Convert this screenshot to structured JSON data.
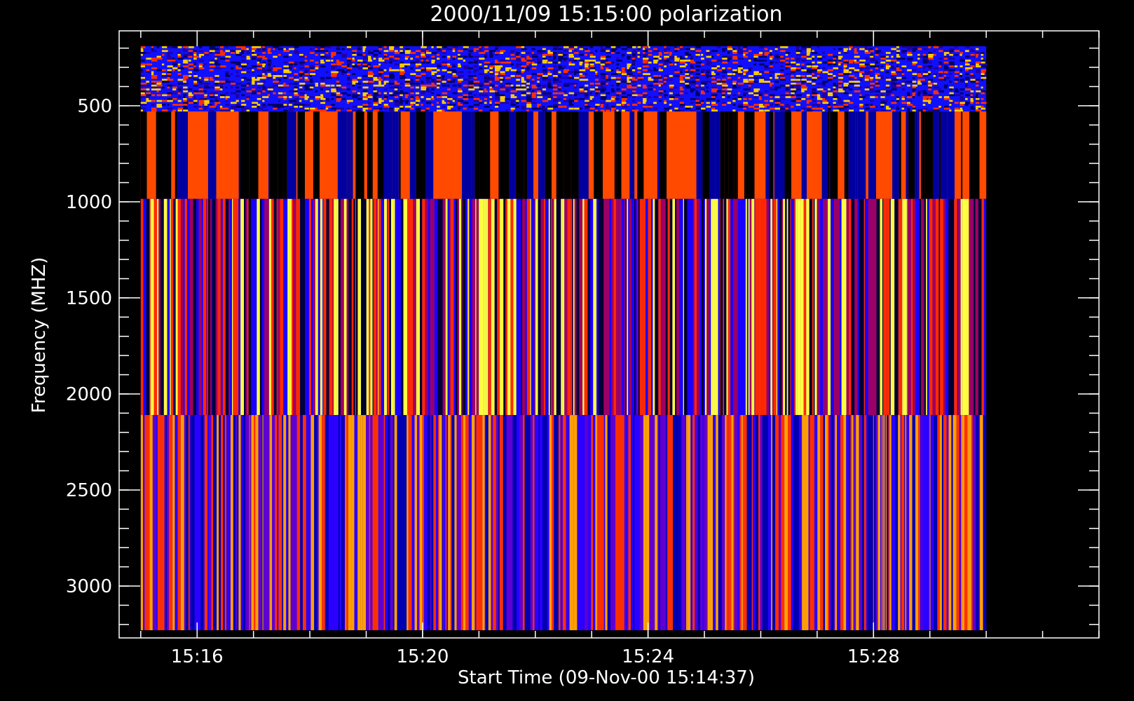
{
  "chart_data": {
    "type": "heatmap",
    "title": "2000/11/09 15:15:00 polarization",
    "xlabel": "Start Time (09-Nov-00 15:14:37)",
    "ylabel": "Frequency (MHZ)",
    "x_axis": {
      "unit": "time",
      "start": "15:14:37",
      "range": [
        "15:14:37",
        "15:32:00"
      ],
      "major_ticks": [
        {
          "value": "15:16",
          "label": "15:16"
        },
        {
          "value": "15:20",
          "label": "15:20"
        },
        {
          "value": "15:24",
          "label": "15:24"
        },
        {
          "value": "15:28",
          "label": "15:28"
        }
      ],
      "minor_tick_interval_minutes": 1
    },
    "y_axis": {
      "unit": "MHz",
      "inverted": true,
      "range": [
        110,
        3270
      ],
      "major_ticks": [
        500,
        1000,
        1500,
        2000,
        2500,
        3000
      ],
      "minor_tick_interval": 100
    },
    "data_time_range": [
      "15:15:00",
      "15:30:00"
    ],
    "bands": [
      {
        "freq_range": [
          190,
          530
        ],
        "pattern": "fine-noise",
        "colors": [
          "#1010ff",
          "#ff3000",
          "#000060",
          "#ffd000",
          "#2000a0"
        ]
      },
      {
        "freq_range": [
          530,
          985
        ],
        "pattern": "vertical-stripes",
        "colors": [
          "#ff4a00",
          "#000000",
          "#0000a0"
        ]
      },
      {
        "freq_range": [
          985,
          2110
        ],
        "pattern": "vertical-stripes",
        "colors": [
          "#1a00ff",
          "#ff2a00",
          "#000030",
          "#ffff40",
          "#a00060"
        ]
      },
      {
        "freq_range": [
          2110,
          3230
        ],
        "pattern": "vertical-stripes",
        "colors": [
          "#2a00ff",
          "#ff3000",
          "#ffa000",
          "#0000b0",
          "#6000d0"
        ]
      }
    ],
    "grid": false,
    "legend": "none",
    "colors": {
      "background": "#000000",
      "axes": "#ffffff",
      "text": "#ffffff"
    }
  }
}
